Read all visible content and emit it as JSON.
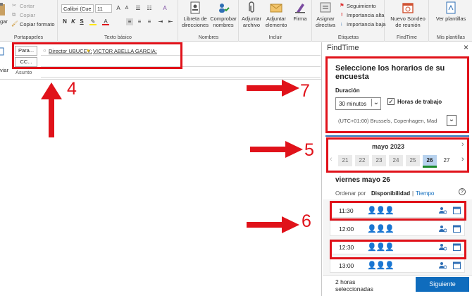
{
  "ribbon": {
    "clipboard": {
      "paste_label": "gar",
      "cut": "Cortar",
      "copy": "Copiar",
      "format": "Copiar formato",
      "group": "Portapapeles"
    },
    "basic_text": {
      "font": "Calibri (Cue",
      "size": "11",
      "group": "Texto básico"
    },
    "names": {
      "address_book": "Libreta de direcciones",
      "check_names": "Comprobar nombres",
      "group": "Nombres"
    },
    "include": {
      "attach_file": "Adjuntar archivo",
      "attach_item": "Adjuntar elemento",
      "signature": "Firma",
      "group": "Incluir"
    },
    "tags": {
      "assign_policy": "Asignar directiva",
      "followup": "Seguimiento",
      "high": "Importancia alta",
      "low": "Importancia baja",
      "group": "Etiquetas"
    },
    "findtime": {
      "new_poll": "Nuevo Sondeo de reunión",
      "group": "FindTime"
    },
    "templates": {
      "view": "Ver plantillas",
      "group": "Mis plantillas"
    }
  },
  "compose": {
    "to_button": "Para...",
    "cc_button": "CC...",
    "send_partial": "viar",
    "subject_label": "Asunto",
    "recipients": [
      "Director UBUCEV;",
      "VICTOR ABELLA GARCIA;"
    ]
  },
  "annotations": {
    "n4": "4",
    "n5": "5",
    "n6": "6",
    "n7": "7"
  },
  "findtime": {
    "title": "FindTime",
    "close": "×",
    "heading": "Seleccione los horarios de su encuesta",
    "duration_label": "Duración",
    "duration_value": "30 minutos",
    "work_hours_label": "Horas de trabajo",
    "timezone": "(UTC+01:00) Brussels, Copenhagen, Mad",
    "month": "mayo 2023",
    "days": [
      "21",
      "22",
      "23",
      "24",
      "25",
      "26",
      "27"
    ],
    "selected_day": "26",
    "day_heading": "viernes mayo 26",
    "order_label": "Ordenar por",
    "order_availability": "Disponibilidad",
    "order_sep": "|",
    "order_time": "Tiempo",
    "slots": [
      "11:30",
      "12:00",
      "12:30",
      "13:00"
    ],
    "footer_text": "2 horas seleccionadas",
    "next_button": "Siguiente",
    "accent": "#0f6cbd",
    "red": "#e0121a"
  }
}
